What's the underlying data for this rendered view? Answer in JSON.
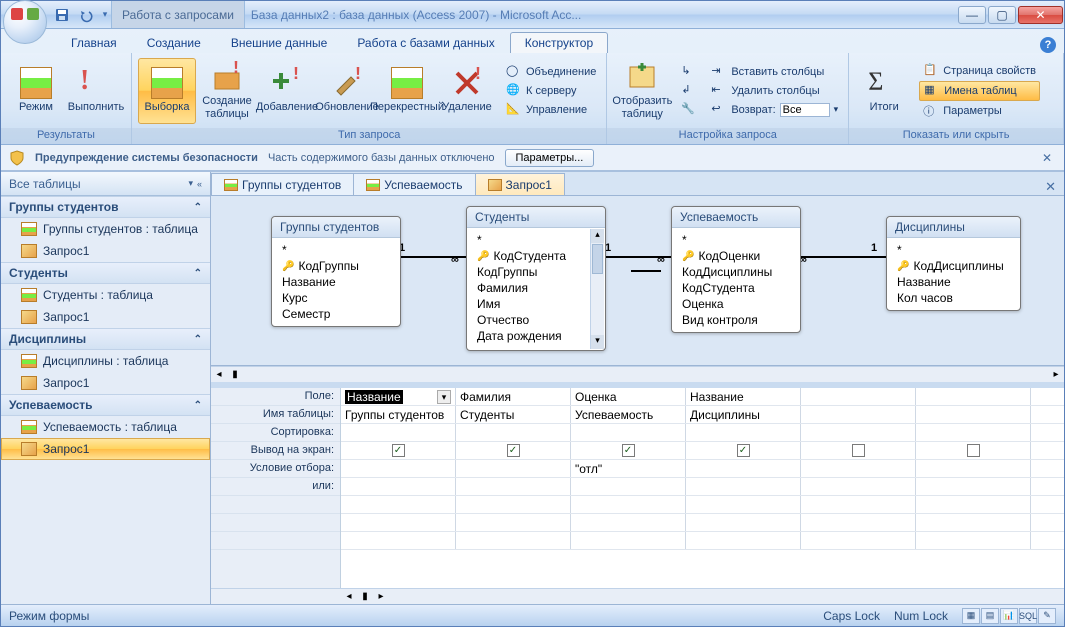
{
  "window": {
    "context_title": "Работа с запросами",
    "title": "База данных2 : база данных (Access 2007) - Microsoft Acc..."
  },
  "tabs": {
    "home": "Главная",
    "create": "Создание",
    "external": "Внешние данные",
    "dbtools": "Работа с базами данных",
    "designer": "Конструктор"
  },
  "ribbon": {
    "results_group": "Результаты",
    "view": "Режим",
    "run": "Выполнить",
    "querytype_group": "Тип запроса",
    "select": "Выборка",
    "maketable": "Создание таблицы",
    "append": "Добавление",
    "update": "Обновление",
    "crosstab": "Перекрестный",
    "delete": "Удаление",
    "union": "Объединение",
    "passthrough": "К серверу",
    "datadef": "Управление",
    "setup_group": "Настройка запроса",
    "showtable": "Отобразить таблицу",
    "insertcols": "Вставить столбцы",
    "deletecols": "Удалить столбцы",
    "return": "Возврат:",
    "return_val": "Все",
    "showhide_group": "Показать или скрыть",
    "totals": "Итоги",
    "propsheet": "Страница свойств",
    "tablenames": "Имена таблиц",
    "parameters": "Параметры"
  },
  "security": {
    "heading": "Предупреждение системы безопасности",
    "message": "Часть содержимого базы данных отключено",
    "button": "Параметры..."
  },
  "nav": {
    "title": "Все таблицы",
    "groups": [
      {
        "name": "Группы студентов",
        "items": [
          {
            "label": "Группы студентов : таблица",
            "type": "table"
          },
          {
            "label": "Запрос1",
            "type": "query"
          }
        ]
      },
      {
        "name": "Студенты",
        "items": [
          {
            "label": "Студенты : таблица",
            "type": "table"
          },
          {
            "label": "Запрос1",
            "type": "query"
          }
        ]
      },
      {
        "name": "Дисциплины",
        "items": [
          {
            "label": "Дисциплины : таблица",
            "type": "table"
          },
          {
            "label": "Запрос1",
            "type": "query"
          }
        ]
      },
      {
        "name": "Успеваемость",
        "items": [
          {
            "label": "Успеваемость : таблица",
            "type": "table"
          },
          {
            "label": "Запрос1",
            "type": "query",
            "selected": true
          }
        ]
      }
    ]
  },
  "docTabs": {
    "t1": "Группы студентов",
    "t2": "Успеваемость",
    "t3": "Запрос1"
  },
  "diagram": {
    "groups": {
      "title": "Группы студентов",
      "fields": [
        "*",
        "КодГруппы",
        "Название",
        "Курс",
        "Семестр"
      ],
      "key": 1
    },
    "students": {
      "title": "Студенты",
      "fields": [
        "*",
        "КодСтудента",
        "КодГруппы",
        "Фамилия",
        "Имя",
        "Отчество",
        "Дата рождения"
      ],
      "key": 1
    },
    "progress": {
      "title": "Успеваемость",
      "fields": [
        "*",
        "КодОценки",
        "КодДисциплины",
        "КодСтудента",
        "Оценка",
        "Вид контроля"
      ],
      "key": 1
    },
    "disc": {
      "title": "Дисциплины",
      "fields": [
        "*",
        "КодДисциплины",
        "Название",
        "Кол часов"
      ],
      "key": 1
    },
    "one": "1",
    "many": "∞"
  },
  "grid": {
    "labels": {
      "field": "Поле:",
      "table": "Имя таблицы:",
      "sort": "Сортировка:",
      "show": "Вывод на экран:",
      "criteria": "Условие отбора:",
      "or": "или:"
    },
    "cols": [
      {
        "field": "Название",
        "table": "Группы студентов",
        "show": true,
        "criteria": ""
      },
      {
        "field": "Фамилия",
        "table": "Студенты",
        "show": true,
        "criteria": ""
      },
      {
        "field": "Оценка",
        "table": "Успеваемость",
        "show": true,
        "criteria": "\"отл\""
      },
      {
        "field": "Название",
        "table": "Дисциплины",
        "show": true,
        "criteria": ""
      },
      {
        "field": "",
        "table": "",
        "show": false,
        "criteria": ""
      },
      {
        "field": "",
        "table": "",
        "show": false,
        "criteria": ""
      }
    ]
  },
  "status": {
    "mode": "Режим формы",
    "caps": "Caps Lock",
    "num": "Num Lock",
    "sql": "SQL"
  }
}
